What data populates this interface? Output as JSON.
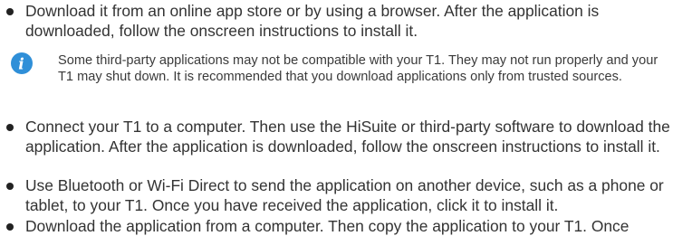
{
  "bullets": [
    "Download it from an online app store or by using a browser. After the application is downloaded, follow the onscreen instructions to install it.",
    "Connect your T1 to a computer. Then use the HiSuite or third-party software to download the application. After the application is downloaded, follow the onscreen instructions to install it.",
    "Use Bluetooth or Wi-Fi Direct to send the application on another device, such as a phone or tablet, to your T1. Once you have received the application, click it to install it.",
    "Download the application from a computer. Then copy the application to your T1. Once"
  ],
  "note": {
    "icon": "info-icon",
    "icon_letter": "i",
    "text": "Some third-party applications may not be compatible with your T1. They may not run properly and your T1 may shut down. It is recommended that you download applications only from trusted sources."
  },
  "colors": {
    "text": "#333333",
    "bullet": "#222222",
    "icon": "#2f8fd8"
  }
}
